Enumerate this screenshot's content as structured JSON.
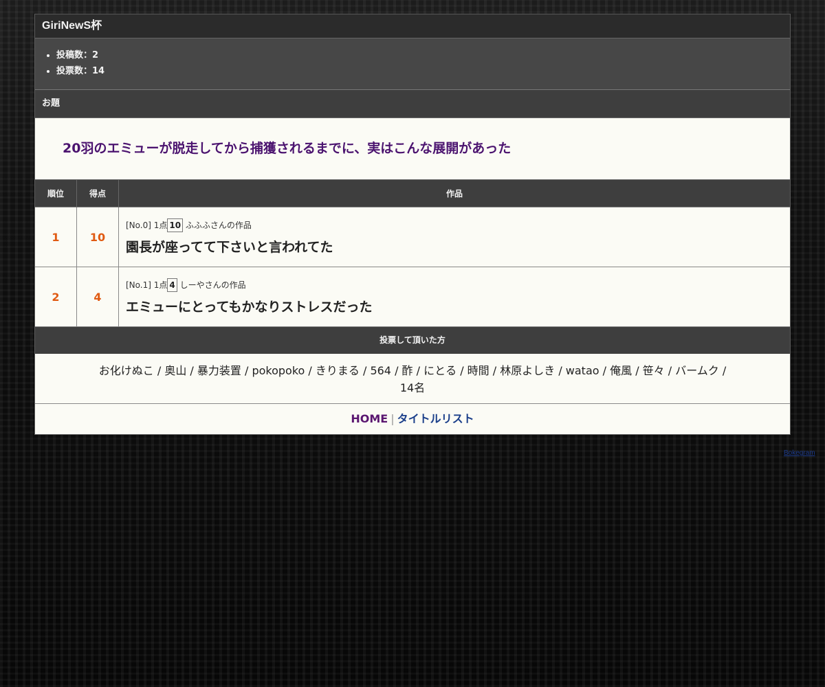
{
  "contest": {
    "title": "GiriNewS杯",
    "stats": [
      "投稿数：2",
      "投票数：14"
    ],
    "theme_label": "お題",
    "theme": "20羽のエミューが脱走してから捕獲されるまでに、実はこんな展開があった"
  },
  "table": {
    "headers": {
      "rank": "順位",
      "score": "得点",
      "work": "作品"
    },
    "rows": [
      {
        "rank": "1",
        "score": "10",
        "entry_no": "[No.0]",
        "point_label": "1点",
        "points": "10",
        "author": "ふふふさんの作品",
        "title": "園長が座ってて下さいと言われてた"
      },
      {
        "rank": "2",
        "score": "4",
        "entry_no": "[No.1]",
        "point_label": "1点",
        "points": "4",
        "author": "しーやさんの作品",
        "title": "エミューにとってもかなりストレスだった"
      }
    ]
  },
  "voters": {
    "heading": "投票して頂いた方",
    "list": "お化けぬこ / 奥山 / 暴力装置 / pokopoko / きりまる / 564 / 酢 / にとる / 時間 / 林原よしき / watao / 俺風 / 笹々 / バームク /",
    "count": "14名"
  },
  "footer": {
    "home": "HOME",
    "separator": "|",
    "list": "タイトルリスト"
  },
  "credit": "Bokegram",
  "colors": {
    "rank_accent": "#e05a12",
    "theme_text": "#4b136f",
    "header_bg": "#3e3e3e"
  }
}
